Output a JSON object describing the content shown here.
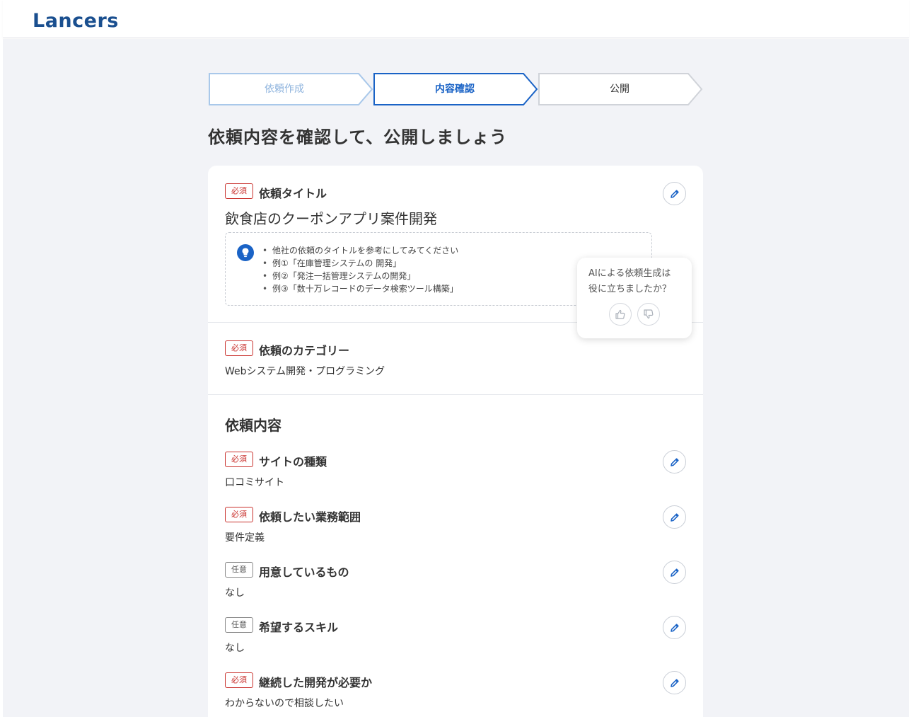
{
  "header": {
    "logo": "Lancers"
  },
  "stepper": {
    "steps": [
      {
        "label": "依頼作成",
        "state": "done"
      },
      {
        "label": "内容確認",
        "state": "current"
      },
      {
        "label": "公開",
        "state": "upcoming"
      }
    ]
  },
  "page_title": "依頼内容を確認して、公開しましょう",
  "badges": {
    "required": "必須",
    "optional": "任意"
  },
  "title_section": {
    "label": "依頼タイトル",
    "value": "飲食店のクーポンアプリ案件開発",
    "hints": [
      "他社の依頼のタイトルを参考にしてみてください",
      "例①「在庫管理システムの 開発」",
      "例②「発注一括管理システムの開発」",
      "例③「数十万レコードのデータ検索ツール構築」"
    ]
  },
  "category_section": {
    "label": "依頼のカテゴリー",
    "value": "Webシステム開発・プログラミング"
  },
  "details": {
    "heading": "依頼内容",
    "fields": [
      {
        "badge": "必須",
        "label": "サイトの種類",
        "value": "口コミサイト"
      },
      {
        "badge": "必須",
        "label": "依頼したい業務範囲",
        "value": "要件定義"
      },
      {
        "badge": "任意",
        "label": "用意しているもの",
        "value": "なし"
      },
      {
        "badge": "任意",
        "label": "希望するスキル",
        "value": "なし"
      },
      {
        "badge": "必須",
        "label": "継続した開発が必要か",
        "value": "わからないので相談したい"
      }
    ]
  },
  "ai_feedback": {
    "line1": "AIによる依頼生成は",
    "line2": "役に立ちましたか？"
  },
  "colors": {
    "brand": "#1a4f8f",
    "accent": "#1a63c6",
    "step_done": "#a9c8ea",
    "required": "#c9302c",
    "background": "#f2f3f7"
  }
}
